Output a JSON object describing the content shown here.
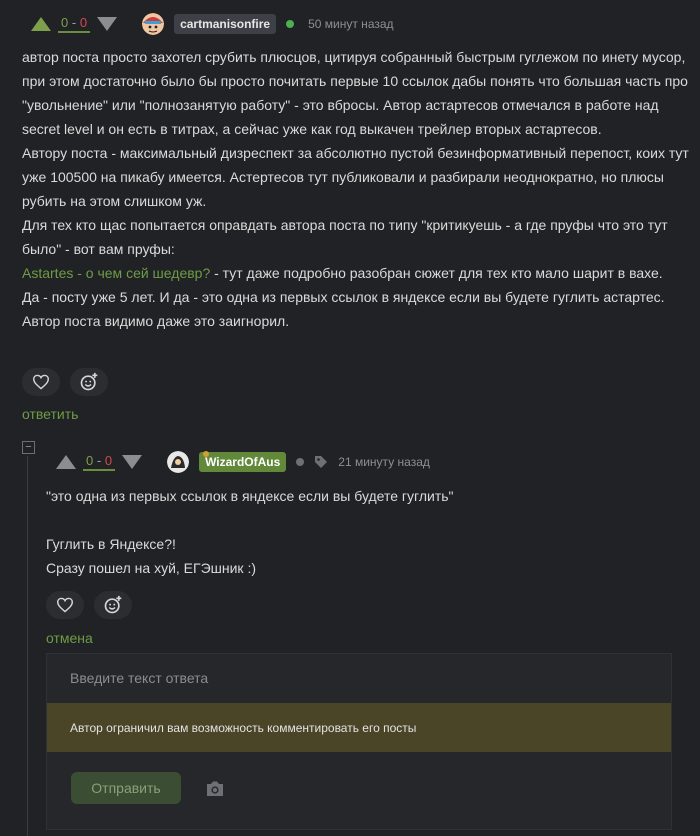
{
  "colors": {
    "background": "#202225",
    "accent_green": "#6e9c45",
    "negative_red": "#d04b4b",
    "username_bg_1": "#3d4046",
    "username_bg_2": "#62883a",
    "online_dot": "#4caf50",
    "warning_bg": "#4b4528"
  },
  "comment": {
    "score_pos": "0",
    "score_sep": "-",
    "score_neg": "0",
    "username": "cartmanisonfire",
    "time": "50 минут назад",
    "text": {
      "p1": "автор поста просто захотел срубить плюсцов, цитируя собранный быстрым гуглежом по инету мусор, при этом достаточно было бы просто почитать первые 10 ссылок дабы понять что большая часть про \"увольнение\" или \"полнозанятую работу\" - это вбросы. Автор астартесов отмечался в работе над secret level и он есть в титрах, а сейчас уже как год выкачен трейлер вторых астартесов.",
      "p2": "Автору поста - максимальный дизреспект за абсолютно пустой безинформативный перепост, коих тут уже 100500 на пикабу имеется. Астертесов тут публиковали и разбирали неоднократно, но плюсы рубить на этом слишком уж.",
      "p3": "Для тех кто щас попытается оправдать автора поста по типу \"критикуешь - а где пруфы что это тут было\" - вот вам пруфы:",
      "link": "Astartes - о чем сей шедевр?",
      "p4_rest": " - тут даже подробно разобран сюжет для тех кто мало шарит в вахе.",
      "p5": "Да - посту уже 5 лет. И да - это одна из первых ссылок в яндексе если вы будете гуглить астартес.",
      "p6": "Автор поста видимо даже это заигнорил."
    },
    "reply_label": "ответить"
  },
  "collapse_symbol": "−",
  "reply": {
    "score_pos": "0",
    "score_sep": "-",
    "score_neg": "0",
    "username": "WizardOfAus",
    "time": "21 минуту назад",
    "text": {
      "line1": "\"это одна из первых ссылок в яндексе если вы будете гуглить\"",
      "line2": "Гуглить в Яндексе?!",
      "line3": "Сразу пошел на хуй, ЕГЭшник :)"
    },
    "cancel_label": "отмена"
  },
  "reply_form": {
    "placeholder": "Введите текст ответа",
    "warning": "Автор ограничил вам возможность комментировать его посты",
    "submit_label": "Отправить"
  },
  "icons": {
    "vote_up": "arrow-up-icon",
    "vote_down": "arrow-down-icon",
    "like": "heart-icon",
    "reaction": "emoji-add-icon",
    "tag": "tag-icon",
    "camera": "camera-icon"
  }
}
